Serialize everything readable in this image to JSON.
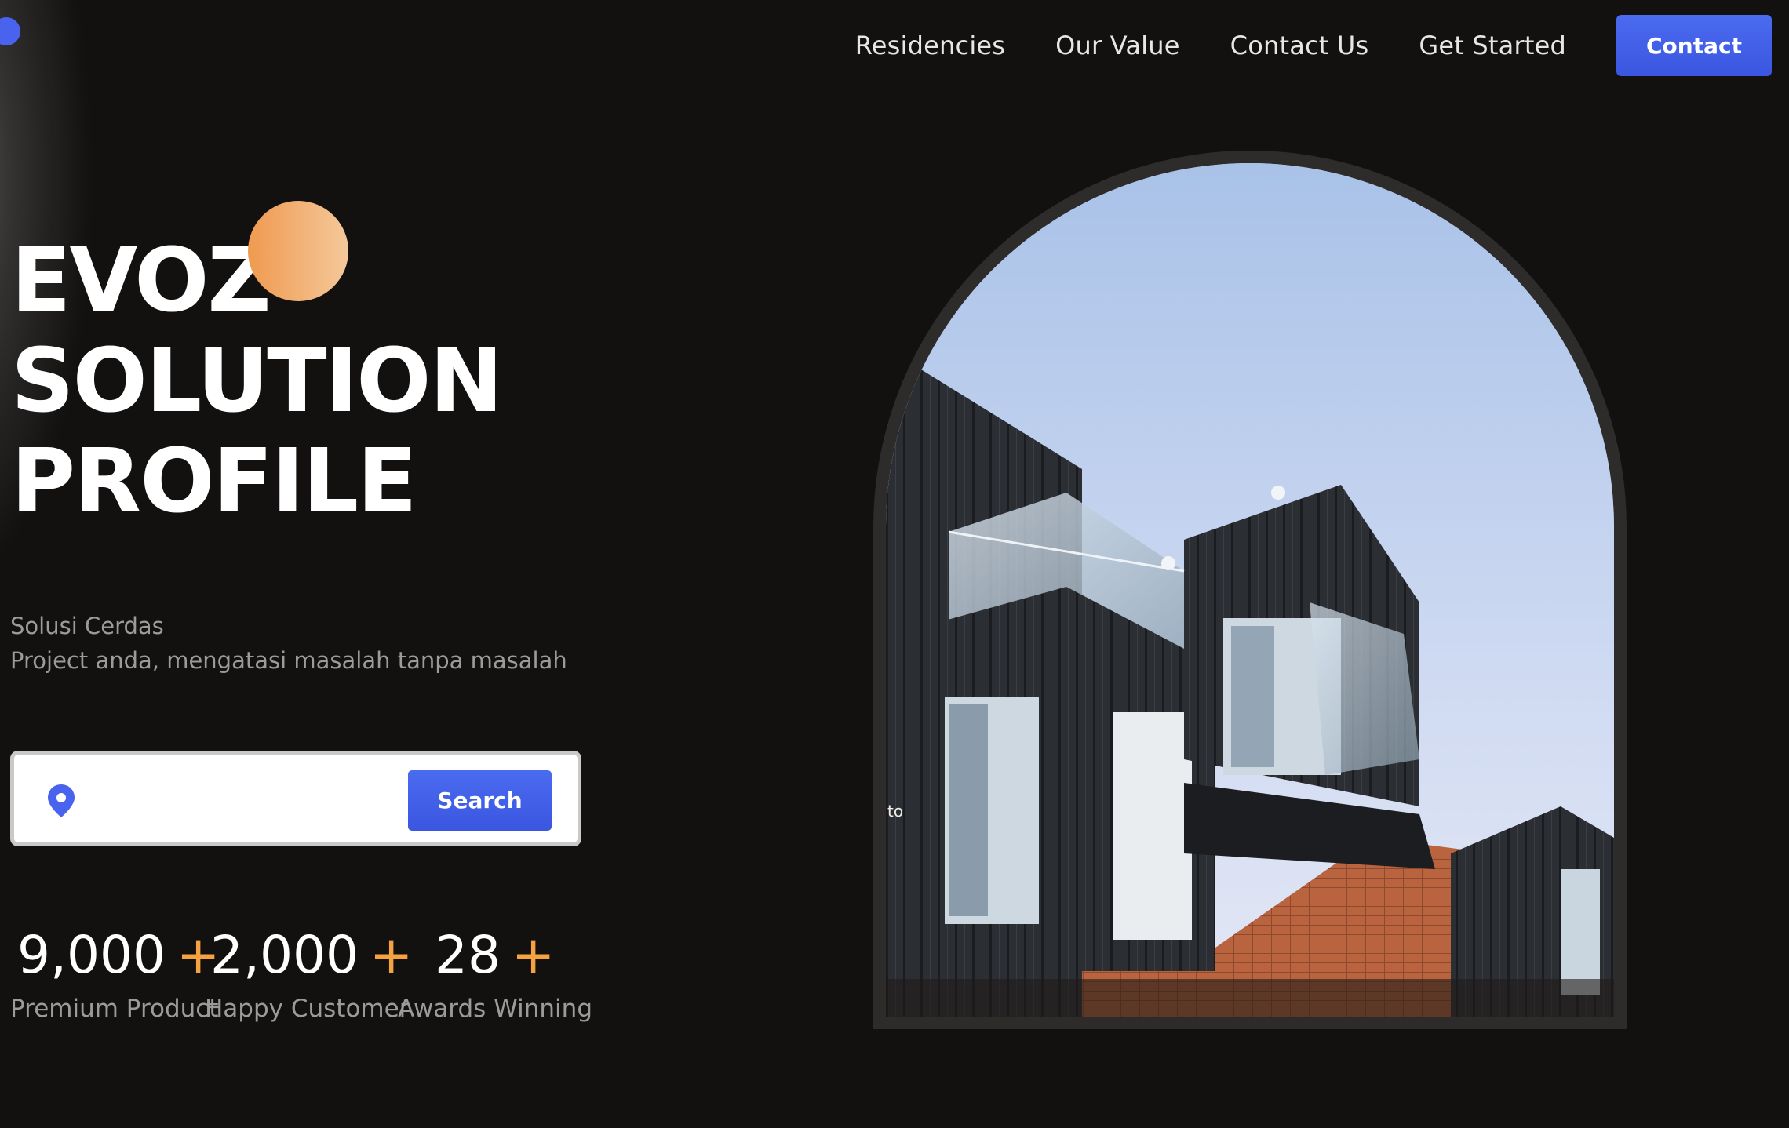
{
  "nav": {
    "links": [
      "Residencies",
      "Our Value",
      "Contact Us",
      "Get Started"
    ],
    "contact_button": "Contact"
  },
  "hero": {
    "title_lines": [
      "EVOZ",
      "SOLUTION",
      "PROFILE"
    ],
    "subtitle_lines": [
      "Solusi Cerdas",
      "Project anda, mengatasi masalah tanpa masalah"
    ]
  },
  "search": {
    "placeholder": "",
    "value": "",
    "button_label": "Search"
  },
  "stats": [
    {
      "value": "9,000",
      "suffix": "+",
      "label": "Premium Product"
    },
    {
      "value": "2,000",
      "suffix": "+",
      "label": "Happy Customer"
    },
    {
      "value": "28",
      "suffix": "+",
      "label": "Awards Winning"
    }
  ],
  "image": {
    "overlay_text": "to"
  },
  "colors": {
    "background": "#131110",
    "accent_blue": "#4a63ee",
    "accent_orange": "#f5a340",
    "text_muted": "#9b9b9b"
  }
}
